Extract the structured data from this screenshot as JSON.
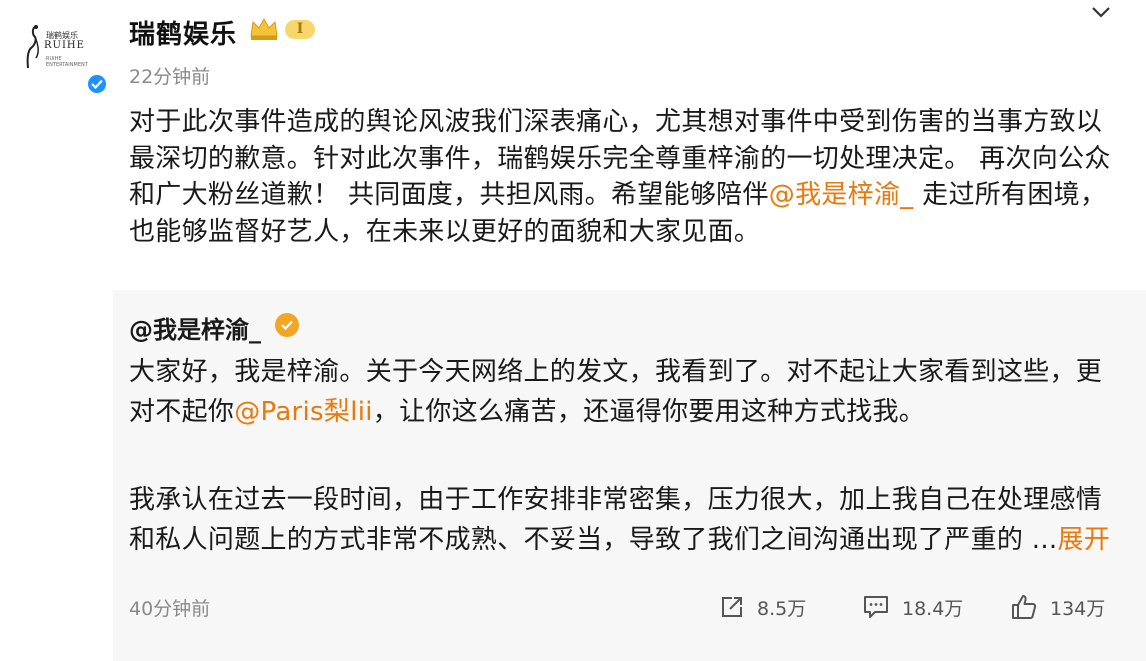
{
  "header": {
    "account_name": "瑞鹤娱乐",
    "vip_level": "I",
    "post_time": "22分钟前",
    "logo": {
      "top": "瑞鹤娱乐",
      "main": "RUIHE",
      "sub": "RUIHE ENTERTAINMENT"
    }
  },
  "post": {
    "text_before_mention": "对于此次事件造成的舆论风波我们深表痛心，尤其想对事件中受到伤害的当事方致以最深切的歉意。针对此次事件，瑞鹤娱乐完全尊重梓渝的一切处理决定。 再次向公众和广大粉丝道歉！ 共同面度，共担风雨。希望能够陪伴",
    "mention": "@我是梓渝_",
    "text_after_mention": " 走过所有困境，也能够监督好艺人，在未来以更好的面貌和大家见面。"
  },
  "repost": {
    "author": "@我是梓渝_",
    "para1_before_mention": "大家好，我是梓渝。关于今天网络上的发文，我看到了。对不起让大家看到这些，更对不起你",
    "para1_mention": "@Paris梨lii",
    "para1_after_mention": "，让你这么痛苦，还逼得你要用这种方式找我。",
    "para2": "我承认在过去一段时间，由于工作安排非常密集，压力很大，加上我自己在处理感情和私人问题上的方式非常不成熟、不妥当，导致了我们之间沟通出现了严重的 ...",
    "expand_label": "展开",
    "time": "40分钟前",
    "stats": {
      "share": "8.5万",
      "comment": "18.4万",
      "like": "134万"
    }
  },
  "colors": {
    "mention": "#e8790c",
    "verified_blue": "#1e90ff",
    "verified_orange": "#f2a623",
    "gray_text": "#8a8a8a"
  },
  "icons": [
    "chevron-down-icon",
    "crown-icon",
    "verified-icon",
    "share-icon",
    "comment-icon",
    "like-icon",
    "crane-logo-icon"
  ]
}
